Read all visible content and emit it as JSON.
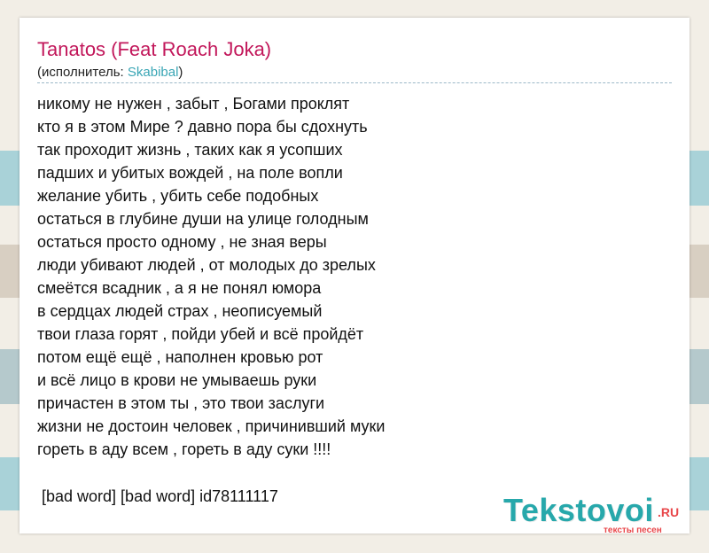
{
  "colors": {
    "title": "#c2185b",
    "artist_link": "#3aa6b5",
    "logo_main": "#27a8ab",
    "logo_accent": "#e8474a",
    "stripe_teal": "#a9d2d8",
    "stripe_tan": "#d8cfc2",
    "stripe_slate": "#b5c9cc",
    "stripe_cream": "#f2eee6"
  },
  "song": {
    "title": "Tanatos (Feat Roach Joka)",
    "artist_prefix": "(исполнитель: ",
    "artist_name": "Skabibal",
    "artist_suffix": ")"
  },
  "lyrics": [
    "никому не нужен , забыт , Богами проклят",
    "кто я в этом Мире ? давно пора бы сдохнуть",
    "так проходит жизнь , таких как я усопших",
    "падших и убитых вождей , на поле вопли",
    "желание убить , убить себе подобных",
    "остаться в глубине души на улице голодным",
    "остаться просто одному , не зная веры",
    "люди убивают людей , от молодых до зрелых",
    "смеётся всадник , а я не понял юмора",
    "в сердцах людей страх , неописуемый",
    "твои глаза горят , пойди убей и всё пройдёт",
    "потом ещё ещё , наполнен кровью рот",
    "и всё лицо в крови не умываешь руки",
    "причастен в этом ты , это твои заслуги",
    "жизни не достоин человек , причинивший муки",
    "гореть в аду всем , гореть в аду суки !!!!"
  ],
  "footer_tags": "[bad word] [bad word] id78111117",
  "logo": {
    "main": "Tekstovoi",
    "tld": ".RU",
    "tagline": "тексты песен"
  }
}
